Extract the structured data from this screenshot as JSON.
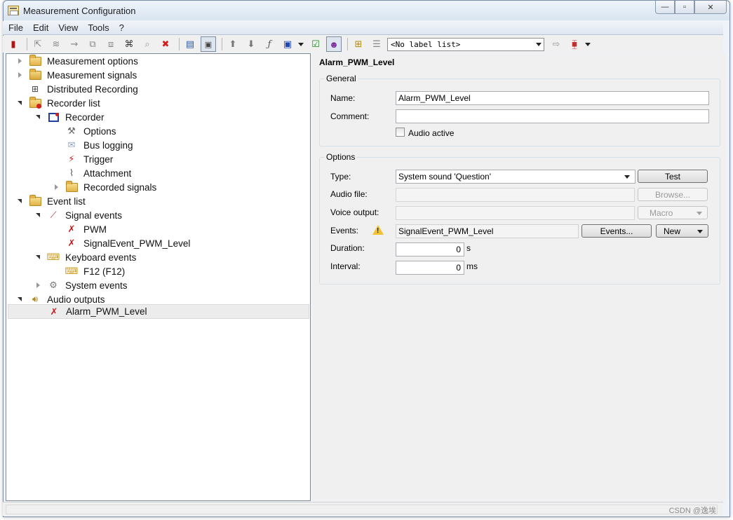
{
  "window": {
    "title": "Measurement Configuration",
    "controls": [
      "—",
      "▫",
      "✕"
    ]
  },
  "menu": [
    "File",
    "Edit",
    "View",
    "Tools",
    "?"
  ],
  "toolbar": {
    "label_list": "<No label list>"
  },
  "tree": [
    {
      "label": "Measurement options",
      "icon": "folder-icon",
      "twisty": "closed"
    },
    {
      "label": "Measurement signals",
      "icon": "folder-signal-icon",
      "twisty": "closed"
    },
    {
      "label": "Distributed Recording",
      "icon": "network-icon",
      "twisty": ""
    },
    {
      "label": "Recorder list",
      "icon": "folder-record-icon",
      "twisty": "open"
    },
    {
      "label": "Recorder",
      "icon": "recorder-icon",
      "twisty": "open"
    },
    {
      "label": "Options",
      "icon": "wrench-icon",
      "twisty": ""
    },
    {
      "label": "Bus logging",
      "icon": "envelope-icon",
      "twisty": ""
    },
    {
      "label": "Trigger",
      "icon": "trigger-icon",
      "twisty": ""
    },
    {
      "label": "Attachment",
      "icon": "paperclip-icon",
      "twisty": ""
    },
    {
      "label": "Recorded signals",
      "icon": "folder-icon",
      "twisty": "closed"
    },
    {
      "label": "Event list",
      "icon": "event-list-icon",
      "twisty": "open"
    },
    {
      "label": "Signal events",
      "icon": "signal-events-icon",
      "twisty": "open"
    },
    {
      "label": "PWM",
      "icon": "signal-event-icon",
      "twisty": ""
    },
    {
      "label": "SignalEvent_PWM_Level",
      "icon": "signal-event-icon",
      "twisty": ""
    },
    {
      "label": "Keyboard events",
      "icon": "keyboard-events-icon",
      "twisty": "open"
    },
    {
      "label": "F12 (F12)",
      "icon": "keyboard-event-icon",
      "twisty": ""
    },
    {
      "label": "System events",
      "icon": "gear-icon",
      "twisty": "closed"
    },
    {
      "label": "Audio outputs",
      "icon": "speaker-icon",
      "twisty": "open"
    },
    {
      "label": "Alarm_PWM_Level",
      "icon": "audio-output-icon",
      "twisty": ""
    }
  ],
  "detail": {
    "heading": "Alarm_PWM_Level",
    "general": {
      "title": "General",
      "name_label": "Name:",
      "name_value": "Alarm_PWM_Level",
      "comment_label": "Comment:",
      "comment_value": "",
      "audio_active_label": "Audio active",
      "audio_active": false
    },
    "options": {
      "title": "Options",
      "type_label": "Type:",
      "type_value": "System sound 'Question'",
      "test_button": "Test",
      "audio_file_label": "Audio file:",
      "audio_file_value": "",
      "browse_button": "Browse...",
      "voice_output_label": "Voice output:",
      "voice_output_value": "",
      "macro_button": "Macro",
      "events_label": "Events:",
      "events_value": "SignalEvent_PWM_Level",
      "events_button": "Events...",
      "new_button": "New",
      "duration_label": "Duration:",
      "duration_value": "0",
      "duration_unit": "s",
      "interval_label": "Interval:",
      "interval_value": "0",
      "interval_unit": "ms"
    }
  },
  "statusbar": {
    "watermark": "CSDN @逸埃"
  }
}
